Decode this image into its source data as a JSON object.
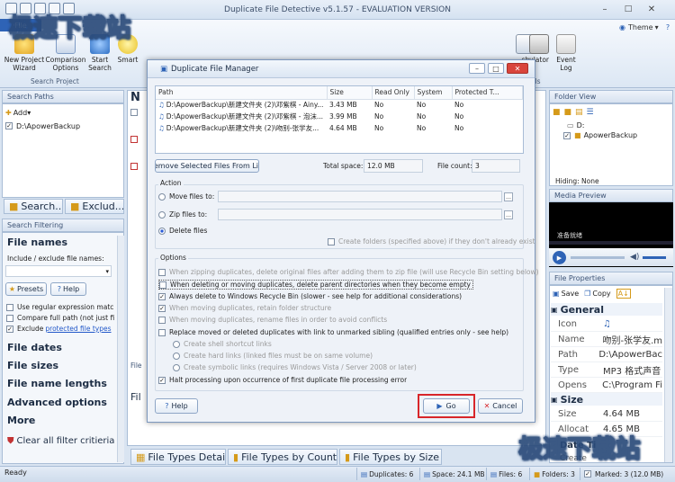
{
  "app": {
    "title": "Duplicate File Detective v5.1.57 - EVALUATION VERSION",
    "file_tab": "File",
    "theme_label": "Theme"
  },
  "watermark": {
    "text": "极速下载站"
  },
  "ribbon": {
    "buttons": [
      "New Project Wizard",
      "Comparison Options",
      "Start Search",
      "Smart"
    ],
    "partial_buttons": [
      "sh",
      "ulator",
      "Event Log"
    ],
    "group_labels": [
      "Search Project",
      "ols"
    ]
  },
  "left": {
    "search_paths_title": "Search Paths",
    "add_label": "Add",
    "paths": [
      "D:\\ApowerBackup"
    ],
    "tabs": [
      "Search...",
      "Exclud..."
    ],
    "filtering_title": "Search Filtering",
    "file_names_heading": "File names",
    "include_label": "Include / exclude file names:",
    "presets_label": "Presets",
    "help_label": "Help",
    "options": [
      "Use regular expression matching",
      "Compare full path (not just file nar",
      "Exclude"
    ],
    "exclude_link": "protected file types",
    "sections": [
      "File dates",
      "File sizes",
      "File name lengths",
      "Advanced options",
      "More"
    ],
    "clear_filter": "Clear all filter critieria"
  },
  "center": {
    "header_char": "N",
    "file_char": "Fil",
    "sub_header": "File",
    "tabs": [
      "File Types Detail",
      "File Types by Count",
      "File Types by Size"
    ]
  },
  "right": {
    "folder_view_title": "Folder View",
    "drive_label": "D:",
    "folder_label": "ApowerBackup",
    "hiding_label": "Hiding: None",
    "media_title": "Media Preview",
    "media_caption": "准备就绪",
    "props_title": "File Properties",
    "save_label": "Save",
    "copy_label": "Copy",
    "general_heading": "General",
    "props": [
      {
        "k": "Icon",
        "v": ""
      },
      {
        "k": "Name",
        "v": "吻别-张学友.m"
      },
      {
        "k": "Path",
        "v": "D:\\ApowerBac"
      },
      {
        "k": "Type",
        "v": "MP3 格式声音"
      },
      {
        "k": "Opens",
        "v": "C:\\Program Fi"
      }
    ],
    "size_heading": "Size",
    "size_props": [
      {
        "k": "Size",
        "v": "4.64 MB"
      },
      {
        "k": "Allocat",
        "v": "4.65 MB"
      }
    ],
    "partial_bottom": "Date Ti",
    "partial_bottom2": "Create"
  },
  "dialog": {
    "title": "Duplicate File Manager",
    "columns": [
      "Path",
      "Size",
      "Read Only",
      "System",
      "Protected T..."
    ],
    "rows": [
      {
        "path": "D:\\ApowerBackup\\新建文件夹 (2)\\邓紫棋 - Ainy...",
        "size": "3.43 MB",
        "ro": "No",
        "sys": "No",
        "prot": "No"
      },
      {
        "path": "D:\\ApowerBackup\\新建文件夹 (2)\\邓紫棋 - 泡沫...",
        "size": "3.99 MB",
        "ro": "No",
        "sys": "No",
        "prot": "No"
      },
      {
        "path": "D:\\ApowerBackup\\新建文件夹 (2)\\吻别-张学友...",
        "size": "4.64 MB",
        "ro": "No",
        "sys": "No",
        "prot": "No"
      }
    ],
    "remove_btn": "Remove Selected Files From List",
    "total_label": "Total space:",
    "total_value": "12.0 MB",
    "count_label": "File count:",
    "count_value": "3",
    "action_title": "Action",
    "move_label": "Move files to:",
    "zip_label": "Zip files to:",
    "delete_label": "Delete files",
    "create_folders": "Create folders (specified above) if they don't already exist",
    "options_title": "Options",
    "options": [
      "When zipping duplicates, delete original files after adding them to zip file (will use Recycle Bin setting below)",
      "When deleting or moving duplicates, delete parent directories when they become empty",
      "Always delete to Windows Recycle Bin (slower - see help for additional considerations)",
      "When moving duplicates, retain folder structure",
      "When moving duplicates, rename files in order to avoid conflicts",
      "Replace moved or deleted duplicates with link to unmarked sibling (qualified entries only - see help)",
      "Create shell shortcut links",
      "Create hard links (linked files must be on same volume)",
      "Create symbolic links (requires Windows Vista / Server 2008 or later)",
      "Halt processing upon occurrence of first duplicate file processing error"
    ],
    "help_btn": "Help",
    "go_btn": "Go",
    "cancel_btn": "Cancel"
  },
  "status": {
    "ready": "Ready",
    "duplicates": "Duplicates: 6",
    "space": "Space: 24.1 MB",
    "files": "Files: 6",
    "folders": "Folders: 3",
    "marked": "Marked: 3 (12.0 MB)"
  }
}
